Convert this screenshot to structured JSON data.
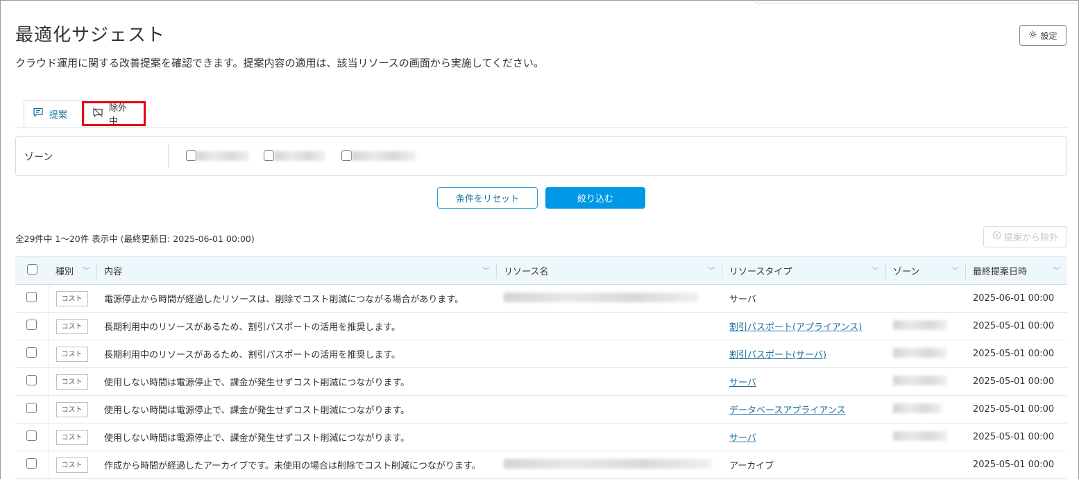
{
  "page": {
    "title": "最適化サジェスト",
    "description": "クラウド運用に関する改善提案を確認できます。提案内容の適用は、該当リソースの画面から実施してください。",
    "settings_label": "設定"
  },
  "tabs": [
    {
      "label": "提案",
      "icon": "comment-icon",
      "active": true
    },
    {
      "label": "除外中",
      "icon": "eye-off-icon",
      "active": false
    }
  ],
  "filter": {
    "zone_label": "ゾーン",
    "zone_options": [
      "",
      "",
      ""
    ]
  },
  "buttons": {
    "reset": "条件をリセット",
    "apply": "絞り込む",
    "exclude": "提案から除外"
  },
  "summary": "全29件中 1〜20件 表示中 (最終更新日: 2025-06-01 00:00)",
  "table": {
    "headers": [
      "種別",
      "内容",
      "リソース名",
      "リソースタイプ",
      "ゾーン",
      "最終提案日時"
    ],
    "rows": [
      {
        "type": "コスト",
        "content": "電源停止から時間が経過したリソースは、削除でコスト削減につながる場合があります。",
        "resource_name": "",
        "resource_type": "サーバ",
        "resource_type_link": false,
        "zone": "",
        "date": "2025-06-01 00:00"
      },
      {
        "type": "コスト",
        "content": "長期利用中のリソースがあるため、割引パスポートの活用を推奨します。",
        "resource_name": "",
        "resource_type": "割引パスポート(アプライアンス)",
        "resource_type_link": true,
        "zone": "",
        "date": "2025-05-01 00:00"
      },
      {
        "type": "コスト",
        "content": "長期利用中のリソースがあるため、割引パスポートの活用を推奨します。",
        "resource_name": "",
        "resource_type": "割引パスポート(サーバ)",
        "resource_type_link": true,
        "zone": "",
        "date": "2025-05-01 00:00"
      },
      {
        "type": "コスト",
        "content": "使用しない時間は電源停止で、課金が発生せずコスト削減につながります。",
        "resource_name": "",
        "resource_type": "サーバ",
        "resource_type_link": true,
        "zone": "",
        "date": "2025-05-01 00:00"
      },
      {
        "type": "コスト",
        "content": "使用しない時間は電源停止で、課金が発生せずコスト削減につながります。",
        "resource_name": "",
        "resource_type": "データベースアプライアンス",
        "resource_type_link": true,
        "zone": "",
        "date": "2025-05-01 00:00"
      },
      {
        "type": "コスト",
        "content": "使用しない時間は電源停止で、課金が発生せずコスト削減につながります。",
        "resource_name": "",
        "resource_type": "サーバ",
        "resource_type_link": true,
        "zone": "",
        "date": "2025-05-01 00:00"
      },
      {
        "type": "コスト",
        "content": "作成から時間が経過したアーカイブです。未使用の場合は削除でコスト削減につながります。",
        "resource_name": "",
        "resource_type": "アーカイブ",
        "resource_type_link": false,
        "zone": "",
        "date": "2025-05-01 00:00"
      }
    ]
  },
  "colors": {
    "accent": "#0098e6",
    "link": "#1a6fa0",
    "highlight": "#e60012",
    "header_bg": "#eef7fb"
  }
}
